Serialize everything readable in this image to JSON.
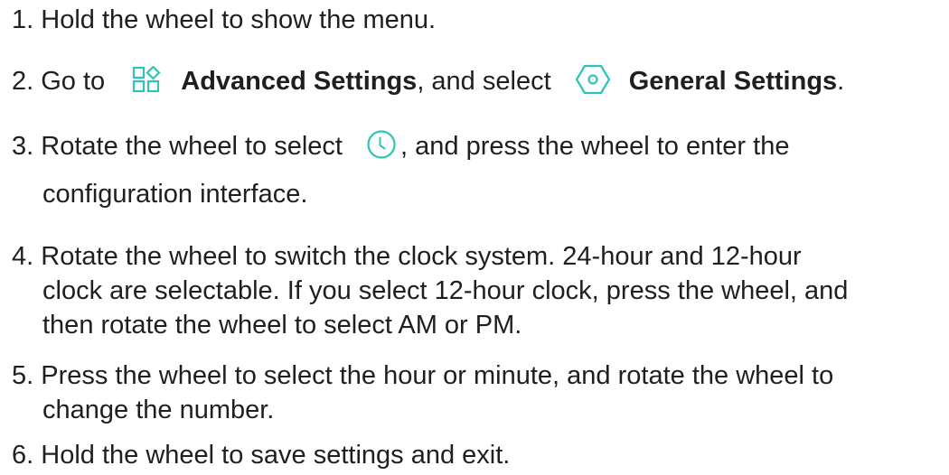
{
  "steps": [
    {
      "number": "1.",
      "text": "Hold the wheel to show the menu."
    },
    {
      "number": "2.",
      "text_before": "Go to",
      "menu_1": "Advanced Settings",
      "text_middle": ", and select",
      "menu_2": "General Settings",
      "text_after": ".",
      "icon_1": "advanced-settings-icon",
      "icon_2": "general-settings-icon"
    },
    {
      "number": "3.",
      "text_before": "Rotate the wheel to select",
      "text_after": ", and press the wheel to enter the",
      "line_2": "configuration interface.",
      "icon": "clock-icon"
    },
    {
      "number": "4.",
      "line_1": "Rotate the wheel to switch the clock system. 24-hour and 12-hour",
      "line_2": "clock are selectable. If you select 12-hour clock, press the wheel, and",
      "line_3": "then rotate the wheel to select AM or PM."
    },
    {
      "number": "5.",
      "line_1": "Press the wheel to select the hour or minute, and rotate the wheel to",
      "line_2": "change the number."
    },
    {
      "number": "6.",
      "text": "Hold the wheel to save settings and exit."
    }
  ],
  "colors": {
    "text": "#1f1f1f",
    "icon_accent": "#2ec4b6"
  }
}
